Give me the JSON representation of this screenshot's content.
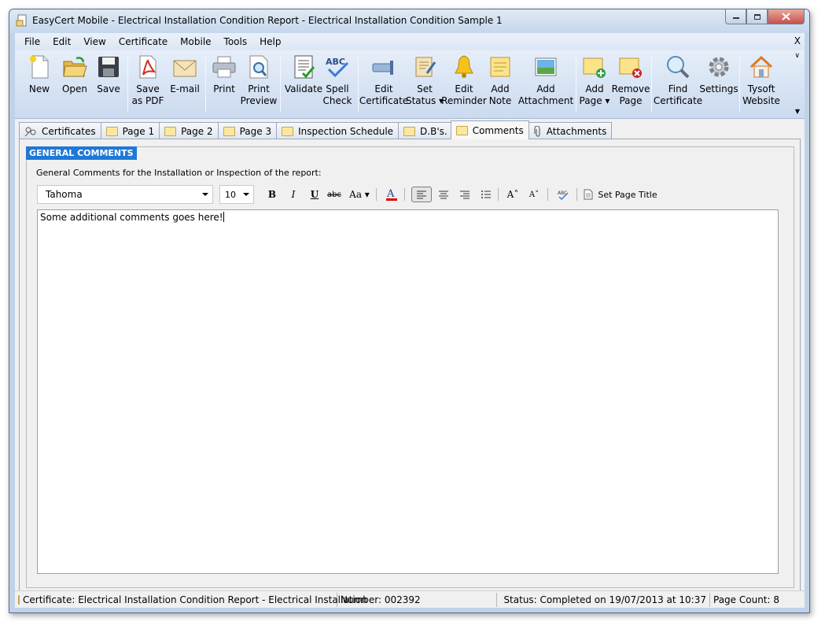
{
  "window": {
    "title": "EasyCert Mobile - Electrical Installation Condition Report - Electrical Installation Condition Sample 1"
  },
  "menu": [
    "File",
    "Edit",
    "View",
    "Certificate",
    "Mobile",
    "Tools",
    "Help"
  ],
  "menu_close": "X",
  "toolbar": {
    "new": "New",
    "open": "Open",
    "save": "Save",
    "save_pdf": "Save\nas PDF",
    "email": "E-mail",
    "print": "Print",
    "print_preview": "Print\nPreview",
    "validate": "Validate",
    "spell_check": "Spell\nCheck",
    "edit_certificate": "Edit\nCertificate",
    "set_status": "Set\nStatus ▾",
    "edit_reminder": "Edit\nReminder",
    "add_note": "Add\nNote",
    "add_attachment": "Add\nAttachment",
    "add_page": "Add\nPage ▾",
    "remove_page": "Remove\nPage",
    "find_certificate": "Find\nCertificate",
    "settings": "Settings",
    "tysoft_website": "Tysoft\nWebsite"
  },
  "tabs": [
    "Certificates",
    "Page 1",
    "Page 2",
    "Page 3",
    "Inspection Schedule",
    "D.B's.",
    "Comments",
    "Attachments"
  ],
  "active_tab": "Comments",
  "comments": {
    "group_title": "GENERAL COMMENTS",
    "description": "General Comments for the Installation or Inspection of the report:",
    "font": "Tahoma",
    "font_size": "10",
    "set_page_title": "Set Page Title",
    "text": "Some additional comments goes here!"
  },
  "status": {
    "certificate": "Certificate: Electrical Installation Condition Report - Electrical Installation",
    "number": "Number: 002392",
    "status": "Status: Completed on 19/07/2013 at 10:37",
    "page_count": "Page Count: 8"
  },
  "colors": {
    "group_title_bg": "#1e78d7",
    "toolbar_bg": "#dbe6f4",
    "font_color_underline": "#e00000"
  }
}
